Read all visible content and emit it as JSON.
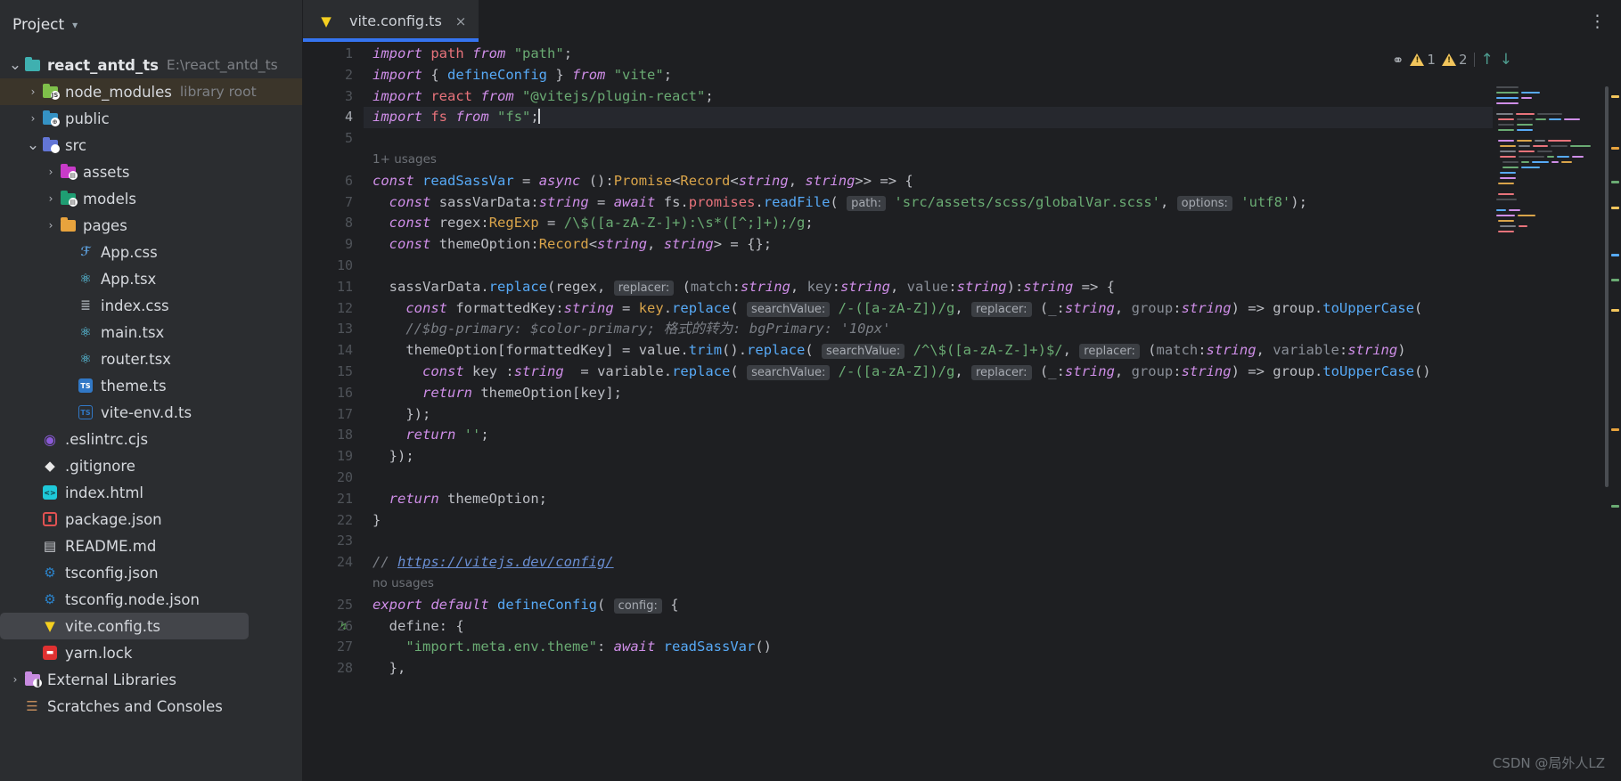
{
  "sidebar": {
    "header": {
      "title": "Project",
      "chevron": "chevron-down-icon"
    },
    "tree": [
      {
        "indent": 0,
        "arrow": "v",
        "icon": "module-icon",
        "color": "#3fb0b0",
        "glyph": "",
        "label": "react_antd_ts",
        "bold": true,
        "sub": "E:\\react_antd_ts",
        "state": "normal"
      },
      {
        "indent": 1,
        "arrow": ">",
        "icon": "folder-node-modules-icon",
        "color": "#7fc04a",
        "glyph": "JS",
        "label": "node_modules",
        "sub": "library root",
        "state": "brown"
      },
      {
        "indent": 1,
        "arrow": ">",
        "icon": "folder-public-icon",
        "color": "#3592c4",
        "glyph": "⊕",
        "label": "public",
        "sub": "",
        "state": "normal"
      },
      {
        "indent": 1,
        "arrow": "v",
        "icon": "folder-source-icon",
        "color": "#6376d6",
        "glyph": "</>",
        "label": "src",
        "sub": "",
        "state": "normal"
      },
      {
        "indent": 2,
        "arrow": ">",
        "icon": "folder-assets-icon",
        "color": "#c83bc8",
        "glyph": "▤",
        "label": "assets",
        "sub": "",
        "state": "normal"
      },
      {
        "indent": 2,
        "arrow": ">",
        "icon": "folder-models-icon",
        "color": "#1f9e73",
        "glyph": "▤",
        "label": "models",
        "sub": "",
        "state": "normal"
      },
      {
        "indent": 2,
        "arrow": ">",
        "icon": "folder-pages-icon",
        "color": "#e8a33d",
        "glyph": "",
        "label": "pages",
        "sub": "",
        "state": "normal"
      },
      {
        "indent": 3,
        "arrow": "",
        "icon": "css-file-icon",
        "color": "#5b9bd5",
        "glyph": "CSS",
        "label": "App.css",
        "sub": "",
        "state": "normal"
      },
      {
        "indent": 3,
        "arrow": "",
        "icon": "react-file-icon",
        "color": "#61dafb",
        "glyph": "⚛",
        "label": "App.tsx",
        "sub": "",
        "state": "normal"
      },
      {
        "indent": 3,
        "arrow": "",
        "icon": "stylesheet-file-icon",
        "color": "#9aa0a6",
        "glyph": "≣",
        "label": "index.css",
        "sub": "",
        "state": "normal"
      },
      {
        "indent": 3,
        "arrow": "",
        "icon": "react-file-icon",
        "color": "#61dafb",
        "glyph": "⚛",
        "label": "main.tsx",
        "sub": "",
        "state": "normal"
      },
      {
        "indent": 3,
        "arrow": "",
        "icon": "react-file-icon",
        "color": "#61dafb",
        "glyph": "⚛",
        "label": "router.tsx",
        "sub": "",
        "state": "normal"
      },
      {
        "indent": 3,
        "arrow": "",
        "icon": "typescript-file-icon",
        "color": "#3178c6",
        "glyph": "TS",
        "label": "theme.ts",
        "sub": "",
        "state": "normal"
      },
      {
        "indent": 3,
        "arrow": "",
        "icon": "typescript-declaration-file-icon",
        "color": "#3178c6",
        "glyph": "TS",
        "label": "vite-env.d.ts",
        "sub": "",
        "state": "normal"
      },
      {
        "indent": 1,
        "arrow": "",
        "icon": "eslint-file-icon",
        "color": "#8b5ad8",
        "glyph": "◉",
        "label": ".eslintrc.cjs",
        "sub": "",
        "state": "normal"
      },
      {
        "indent": 1,
        "arrow": "",
        "icon": "git-file-icon",
        "color": "#e8e8e8",
        "glyph": "◈",
        "label": ".gitignore",
        "sub": "",
        "state": "normal"
      },
      {
        "indent": 1,
        "arrow": "",
        "icon": "html-file-icon",
        "color": "#1ec8d8",
        "glyph": "<>",
        "label": "index.html",
        "sub": "",
        "state": "normal"
      },
      {
        "indent": 1,
        "arrow": "",
        "icon": "npm-package-file-icon",
        "color": "#e05252",
        "glyph": "■",
        "label": "package.json",
        "sub": "",
        "state": "normal"
      },
      {
        "indent": 1,
        "arrow": "",
        "icon": "markdown-file-icon",
        "color": "#c9ccd1",
        "glyph": "▤",
        "label": "README.md",
        "sub": "",
        "state": "normal"
      },
      {
        "indent": 1,
        "arrow": "",
        "icon": "tsconfig-file-icon",
        "color": "#2b82c9",
        "glyph": "TS",
        "label": "tsconfig.json",
        "sub": "",
        "state": "normal"
      },
      {
        "indent": 1,
        "arrow": "",
        "icon": "tsconfig-file-icon",
        "color": "#2b82c9",
        "glyph": "TS",
        "label": "tsconfig.node.json",
        "sub": "",
        "state": "normal"
      },
      {
        "indent": 1,
        "arrow": "",
        "icon": "vite-file-icon",
        "color": "#f5d020",
        "glyph": "⚡",
        "label": "vite.config.ts",
        "sub": "",
        "state": "selected"
      },
      {
        "indent": 1,
        "arrow": "",
        "icon": "lock-file-icon",
        "color": "#e03131",
        "glyph": "🔒",
        "label": "yarn.lock",
        "sub": "",
        "state": "normal"
      },
      {
        "indent": 0,
        "arrow": ">",
        "icon": "external-libraries-icon",
        "color": "#c88be0",
        "glyph": "▐",
        "label": "External Libraries",
        "sub": "",
        "state": "normal"
      },
      {
        "indent": 0,
        "arrow": "",
        "icon": "scratches-icon",
        "color": "#c08a5a",
        "glyph": "☰",
        "label": "Scratches and Consoles",
        "sub": "",
        "state": "normal"
      }
    ]
  },
  "editor": {
    "tab": {
      "title": "vite.config.ts",
      "icon": "vite-file-icon",
      "close": "×"
    },
    "menu_icon": "more-vertical-icon",
    "inspections": {
      "eye_icon": "eye-off-icon",
      "warning_icon": "warning-triangle-icon",
      "warning_count_1": "1",
      "warning_count_2": "2",
      "prev_icon": "arrow-up-icon",
      "next_icon": "arrow-down-icon"
    },
    "watermark": "CSDN @局外人LZ",
    "gutter_numbers": [
      "1",
      "2",
      "3",
      "4",
      "5",
      "6",
      "7",
      "8",
      "9",
      "10",
      "11",
      "12",
      "13",
      "14",
      "15",
      "16",
      "17",
      "18",
      "19",
      "20",
      "21",
      "22",
      "23",
      "24",
      "25",
      "26",
      "27",
      "28"
    ],
    "usage_hints": {
      "read_sass_var": "1+ usages",
      "export_default": "no usages"
    },
    "code_lines": [
      "import path from \"path\";",
      "import { defineConfig } from \"vite\";",
      "import react from \"@vitejs/plugin-react\";",
      "import fs from \"fs\";",
      "",
      "const readSassVar = async ():Promise<Record<string, string>> => {",
      "  const sassVarData:string = await fs.promises.readFile( path: 'src/assets/scss/globalVar.scss', options: 'utf8');",
      "  const regex:RegExp = /\\$([a-zA-Z-]+):\\s*([^;]+);/g;",
      "  const themeOption:Record<string, string> = {};",
      "",
      "  sassVarData.replace(regex, replacer: (match:string, key:string, value:string):string => {",
      "    const formattedKey:string = key.replace( searchValue: /-([a-zA-Z])/g, replacer: (_:string, group:string) => group.toUpperCase())",
      "    //$bg-primary: $color-primary; 格式的转为: bgPrimary: '10px'",
      "    themeOption[formattedKey] = value.trim().replace( searchValue: /^\\$([a-zA-Z-]+)$/, replacer: (match:string, variable:string) =",
      "      const key :string = variable.replace( searchValue: /-([a-zA-Z])/g, replacer: (_:string, group:string) => group.toUpperCase())",
      "      return themeOption[key];",
      "    });",
      "    return '';",
      "  });",
      "",
      "  return themeOption;",
      "}",
      "",
      "// https://vitejs.dev/config/",
      "export default defineConfig( config: {",
      "  define: {",
      "    \"import.meta.env.theme\": await readSassVar()",
      "  },"
    ]
  }
}
